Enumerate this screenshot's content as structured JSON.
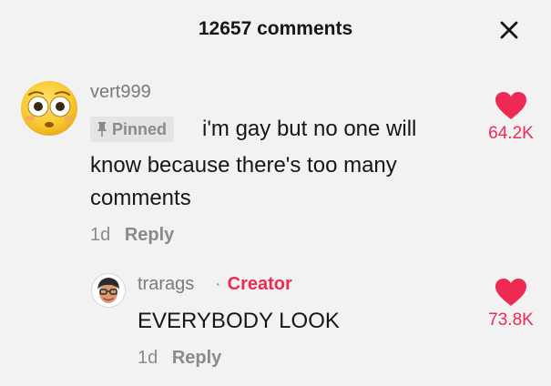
{
  "header": {
    "title": "12657 comments"
  },
  "comments": [
    {
      "username": "vert999",
      "pinned_label": "Pinned",
      "text_lines": [
        "i'm gay but no one will",
        "know because there's too many",
        "comments"
      ],
      "time": "1d",
      "reply_label": "Reply",
      "likes": "64.2K"
    },
    {
      "username": "trarags",
      "creator_separator": "·",
      "creator_label": "Creator",
      "text": "EVERYBODY LOOK",
      "time": "1d",
      "reply_label": "Reply",
      "likes": "73.8K"
    }
  ],
  "icons": {
    "close": "close-icon",
    "pin": "pin-icon",
    "heart": "heart-icon",
    "avatar1": "flushed-emoji-avatar",
    "avatar2": "cartoon-face-avatar"
  },
  "colors": {
    "accent": "#ee2a53",
    "muted": "#8a8a8a",
    "text": "#161616",
    "background": "#f2f2f2"
  }
}
